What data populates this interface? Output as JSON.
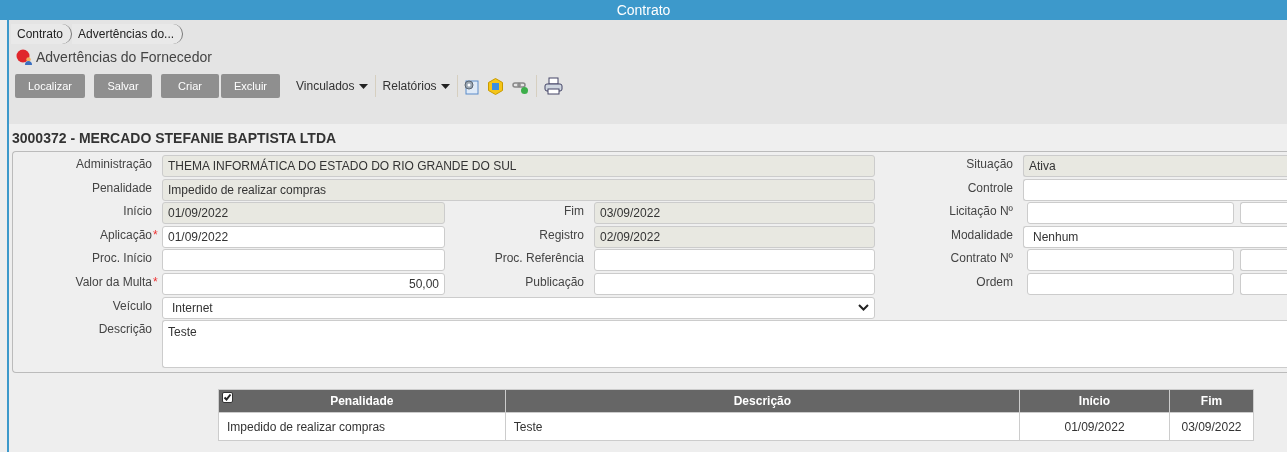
{
  "window": {
    "title": "Contrato"
  },
  "breadcrumbs": [
    "Contrato",
    "Advertências do..."
  ],
  "page_title": "Advertências do Fornecedor",
  "toolbar": {
    "button_groups": [
      [
        "Localizar"
      ],
      [
        "Salvar"
      ],
      [
        "Criar",
        "Excluir"
      ]
    ],
    "menus": [
      "Vinculados",
      "Relatórios"
    ]
  },
  "record_title": "3000372 - MERCADO STEFANIE BAPTISTA LTDA",
  "form": {
    "rows": [
      {
        "left": {
          "label": "Administração",
          "kind": "readonly",
          "value": "THEMA INFORMÁTICA DO ESTADO DO RIO GRANDE DO SUL",
          "wide": true
        },
        "right": {
          "label": "Situação",
          "kind": "readonly",
          "value": "Ativa"
        }
      },
      {
        "left": {
          "label": "Penalidade",
          "kind": "readonly",
          "value": "Impedido de realizar compras",
          "wide": true
        },
        "right": {
          "label": "Controle",
          "kind": "input"
        }
      },
      {
        "left": {
          "label": "Início",
          "kind": "readonly",
          "value": "01/09/2022",
          "wide": false
        },
        "middle": {
          "label": "Fim",
          "kind": "readonly",
          "value": "03/09/2022"
        },
        "right": {
          "label": "Licitação Nº",
          "kind": "split"
        }
      },
      {
        "left": {
          "label": "Aplicação",
          "required_mark": "*",
          "kind": "input",
          "value": "01/09/2022",
          "wide": false
        },
        "middle": {
          "label": "Registro",
          "kind": "readonly",
          "value": "02/09/2022"
        },
        "right": {
          "label": "Modalidade",
          "kind": "choice",
          "value": "Nenhum"
        }
      },
      {
        "left": {
          "label": "Proc. Início",
          "kind": "input",
          "wide": false
        },
        "middle": {
          "label": "Proc. Referência",
          "kind": "input"
        },
        "right": {
          "label": "Contrato Nº",
          "kind": "split"
        }
      },
      {
        "left": {
          "label": "Valor da Multa",
          "required_mark": "*",
          "kind": "number",
          "value": "50,00",
          "wide": false
        },
        "middle": {
          "label": "Publicação",
          "kind": "input"
        },
        "right": {
          "label": "Ordem",
          "kind": "split"
        }
      },
      {
        "left": {
          "label": "Veículo",
          "kind": "select",
          "value": "Internet",
          "wide": true
        }
      },
      {
        "left": {
          "label": "Descrição",
          "kind": "textarea",
          "value": "Teste",
          "wide": true
        }
      }
    ]
  },
  "table": {
    "select_all_checked": true,
    "columns": [
      "Penalidade",
      "Descrição",
      "Início",
      "Fim"
    ],
    "rows": [
      [
        "Impedido de realizar compras",
        "Teste",
        "01/09/2022",
        "03/09/2022"
      ]
    ]
  }
}
